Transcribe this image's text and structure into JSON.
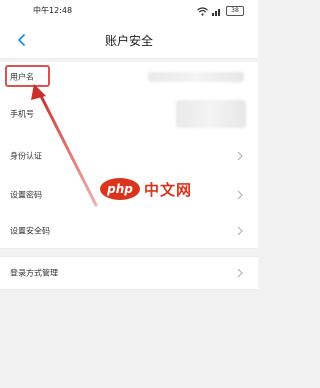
{
  "status_bar": {
    "time": "中午12:48",
    "battery": "38"
  },
  "nav": {
    "title": "账户安全"
  },
  "rows": [
    {
      "label": "用户名"
    },
    {
      "label": "手机号"
    },
    {
      "label": "身份认证"
    },
    {
      "label": "设置密码"
    },
    {
      "label": "设置安全码"
    },
    {
      "label": "登录方式管理"
    }
  ],
  "watermark": {
    "logo": "php",
    "text": "中文网"
  },
  "colors": {
    "highlight": "#d9534f",
    "accent": "#1e90ff",
    "watermark": "#d81e06"
  }
}
